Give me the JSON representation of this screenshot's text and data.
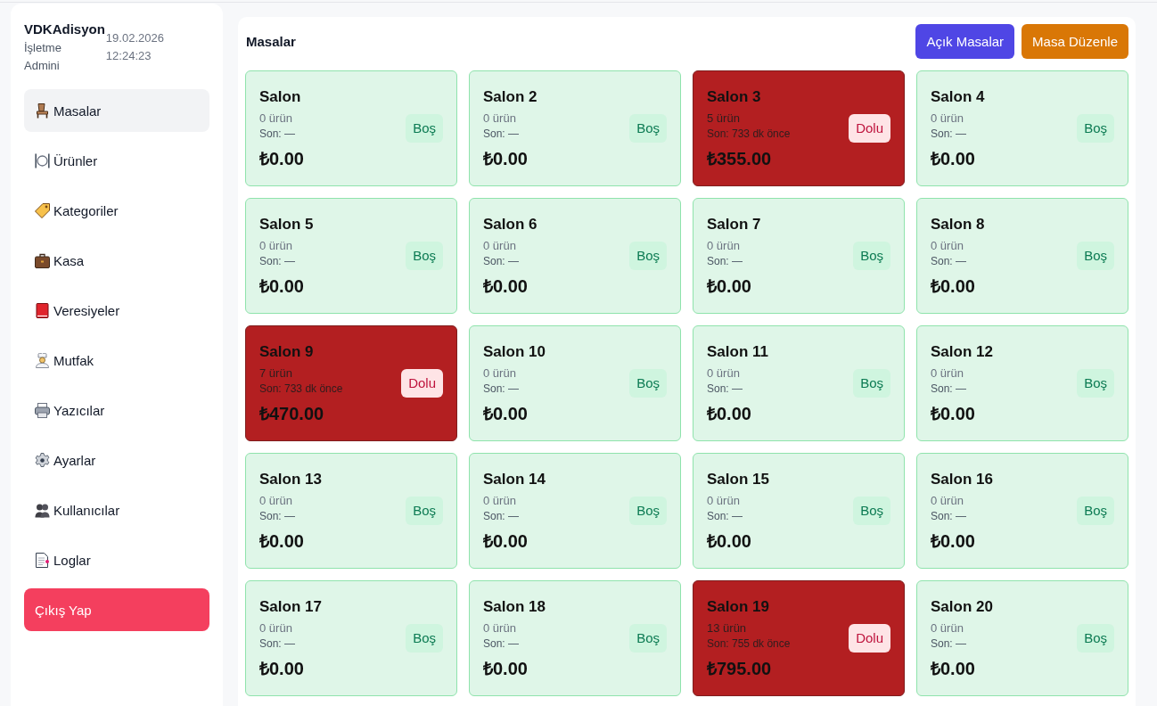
{
  "sidebar": {
    "brand": "VDKAdisyon",
    "role": "İşletme Admini",
    "datetime": "19.02.2026 12:24:23",
    "items": [
      {
        "label": "Masalar",
        "selected": true
      },
      {
        "label": "Ürünler",
        "selected": false
      },
      {
        "label": "Kategoriler",
        "selected": false
      },
      {
        "label": "Kasa",
        "selected": false
      },
      {
        "label": "Veresiyeler",
        "selected": false
      },
      {
        "label": "Mutfak",
        "selected": false
      },
      {
        "label": "Yazıcılar",
        "selected": false
      },
      {
        "label": "Ayarlar",
        "selected": false
      },
      {
        "label": "Kullanıcılar",
        "selected": false
      },
      {
        "label": "Loglar",
        "selected": false
      }
    ],
    "logout": "Çıkış Yap"
  },
  "main": {
    "title": "Masalar",
    "buttons": [
      {
        "label": "Açık Masalar",
        "kind": "primary"
      },
      {
        "label": "Masa Düzenle",
        "kind": "warning"
      }
    ]
  },
  "tables": [
    {
      "name": "Salon",
      "items": "0 ürün",
      "last": "Son: —",
      "total": "₺0.00",
      "status": "Boş",
      "occupied": false
    },
    {
      "name": "Salon 2",
      "items": "0 ürün",
      "last": "Son: —",
      "total": "₺0.00",
      "status": "Boş",
      "occupied": false
    },
    {
      "name": "Salon 3",
      "items": "5 ürün",
      "last": "Son: 733 dk önce",
      "total": "₺355.00",
      "status": "Dolu",
      "occupied": true
    },
    {
      "name": "Salon 4",
      "items": "0 ürün",
      "last": "Son: —",
      "total": "₺0.00",
      "status": "Boş",
      "occupied": false
    },
    {
      "name": "Salon 5",
      "items": "0 ürün",
      "last": "Son: —",
      "total": "₺0.00",
      "status": "Boş",
      "occupied": false
    },
    {
      "name": "Salon 6",
      "items": "0 ürün",
      "last": "Son: —",
      "total": "₺0.00",
      "status": "Boş",
      "occupied": false
    },
    {
      "name": "Salon 7",
      "items": "0 ürün",
      "last": "Son: —",
      "total": "₺0.00",
      "status": "Boş",
      "occupied": false
    },
    {
      "name": "Salon 8",
      "items": "0 ürün",
      "last": "Son: —",
      "total": "₺0.00",
      "status": "Boş",
      "occupied": false
    },
    {
      "name": "Salon 9",
      "items": "7 ürün",
      "last": "Son: 733 dk önce",
      "total": "₺470.00",
      "status": "Dolu",
      "occupied": true
    },
    {
      "name": "Salon 10",
      "items": "0 ürün",
      "last": "Son: —",
      "total": "₺0.00",
      "status": "Boş",
      "occupied": false
    },
    {
      "name": "Salon 11",
      "items": "0 ürün",
      "last": "Son: —",
      "total": "₺0.00",
      "status": "Boş",
      "occupied": false
    },
    {
      "name": "Salon 12",
      "items": "0 ürün",
      "last": "Son: —",
      "total": "₺0.00",
      "status": "Boş",
      "occupied": false
    },
    {
      "name": "Salon 13",
      "items": "0 ürün",
      "last": "Son: —",
      "total": "₺0.00",
      "status": "Boş",
      "occupied": false
    },
    {
      "name": "Salon 14",
      "items": "0 ürün",
      "last": "Son: —",
      "total": "₺0.00",
      "status": "Boş",
      "occupied": false
    },
    {
      "name": "Salon 15",
      "items": "0 ürün",
      "last": "Son: —",
      "total": "₺0.00",
      "status": "Boş",
      "occupied": false
    },
    {
      "name": "Salon 16",
      "items": "0 ürün",
      "last": "Son: —",
      "total": "₺0.00",
      "status": "Boş",
      "occupied": false
    },
    {
      "name": "Salon 17",
      "items": "0 ürün",
      "last": "Son: —",
      "total": "₺0.00",
      "status": "Boş",
      "occupied": false
    },
    {
      "name": "Salon 18",
      "items": "0 ürün",
      "last": "Son: —",
      "total": "₺0.00",
      "status": "Boş",
      "occupied": false
    },
    {
      "name": "Salon 19",
      "items": "13 ürün",
      "last": "Son: 755 dk önce",
      "total": "₺795.00",
      "status": "Dolu",
      "occupied": true
    },
    {
      "name": "Salon 20",
      "items": "0 ürün",
      "last": "Son: —",
      "total": "₺0.00",
      "status": "Boş",
      "occupied": false
    }
  ]
}
